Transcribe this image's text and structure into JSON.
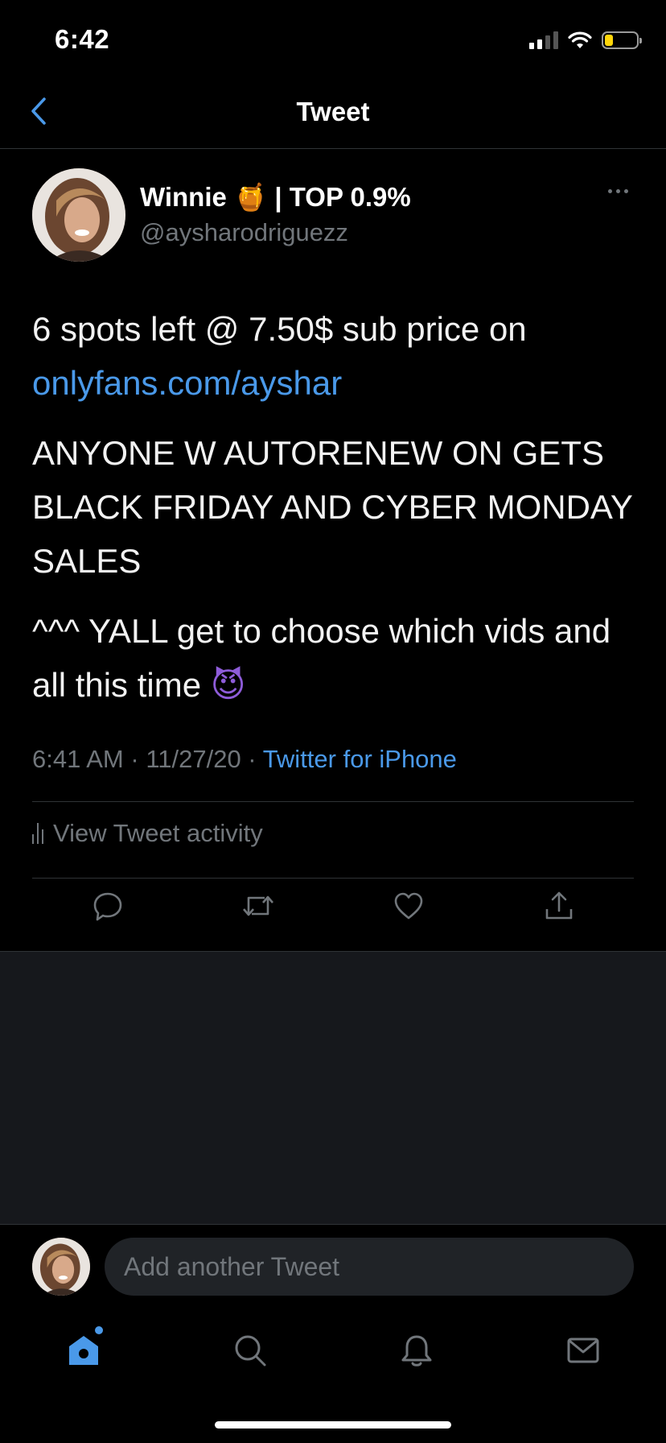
{
  "status_bar": {
    "time": "6:42",
    "battery_level": 0.25,
    "battery_color": "#ffd60a"
  },
  "nav": {
    "title": "Tweet",
    "back_icon": "chevron-left-icon"
  },
  "tweet": {
    "author_name": "Winnie",
    "author_emoji": "🍯",
    "author_suffix": "| TOP 0.9%",
    "author_handle": "@aysharodriguezz",
    "body_line1": "6 spots left @ 7.50$ sub price on",
    "body_link": "onlyfans.com/ayshar",
    "body_para2": "ANYONE W AUTORENEW ON GETS BLACK FRIDAY AND CYBER MONDAY SALES",
    "body_para3": "^^^ YALL get to choose which vids and all this time",
    "body_para3_emoji": "😈",
    "time": "6:41 AM",
    "date": "11/27/20",
    "source": "Twitter for iPhone",
    "activity_label": "View Tweet activity"
  },
  "actions": [
    {
      "name": "reply-icon"
    },
    {
      "name": "retweet-icon"
    },
    {
      "name": "like-icon"
    },
    {
      "name": "share-icon"
    }
  ],
  "composer": {
    "placeholder": "Add another Tweet"
  },
  "tabs": [
    {
      "name": "home-icon",
      "active": true
    },
    {
      "name": "search-icon"
    },
    {
      "name": "bell-icon"
    },
    {
      "name": "mail-icon"
    }
  ],
  "colors": {
    "accent": "#4a99e9",
    "background": "#000000",
    "muted_text": "#71767b",
    "divider": "#2f3336"
  }
}
